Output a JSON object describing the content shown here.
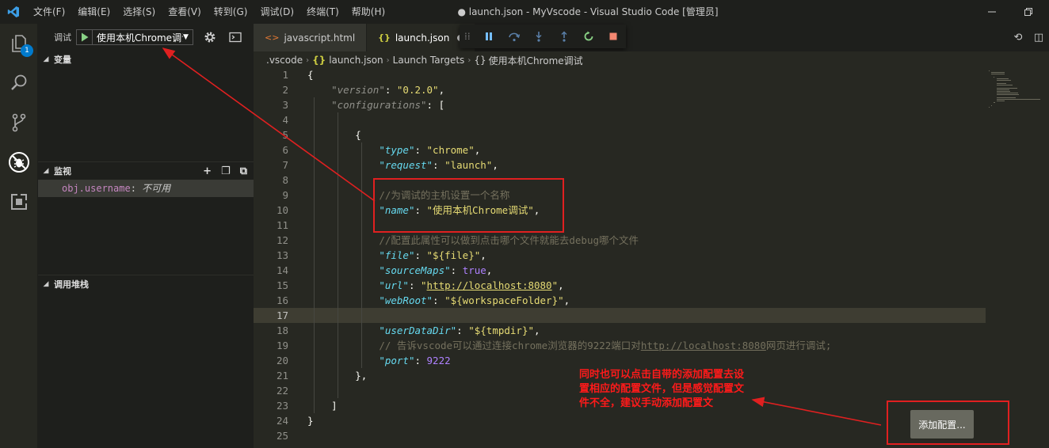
{
  "window": {
    "title": "● launch.json - MyVscode - Visual Studio Code [管理员]",
    "menu": [
      "文件(F)",
      "编辑(E)",
      "选择(S)",
      "查看(V)",
      "转到(G)",
      "调试(D)",
      "终端(T)",
      "帮助(H)"
    ]
  },
  "activity": {
    "explorer_badge": "1"
  },
  "sidebar": {
    "debug_label": "调试",
    "config_name": "使用本机Chrome调试",
    "sections": {
      "variables": "变量",
      "watch": "监视",
      "call_stack": "调用堆栈"
    },
    "watch_items": [
      {
        "name": "obj.username",
        "value": "不可用"
      }
    ]
  },
  "tabs": [
    {
      "label": "javascript.html",
      "icon": "html-icon",
      "active": false
    },
    {
      "label": "launch.json",
      "icon": "json-icon",
      "active": true,
      "dirty": true
    }
  ],
  "breadcrumb": [
    ".vscode",
    "launch.json",
    "Launch Targets",
    "使用本机Chrome调试"
  ],
  "code_lines": [
    "{",
    "    \"version\": \"0.2.0\",",
    "    \"configurations\": [",
    "",
    "        {",
    "            \"type\": \"chrome\",",
    "            \"request\": \"launch\",",
    "",
    "            //为调试的主机设置一个名称",
    "            \"name\": \"使用本机Chrome调试\",",
    "",
    "            //配置此属性可以做到点击哪个文件就能去debug哪个文件",
    "            \"file\": \"${file}\",",
    "            \"sourceMaps\": true,",
    "            \"url\": \"http://localhost:8080\",",
    "            \"webRoot\": \"${workspaceFolder}\",",
    "",
    "            \"userDataDir\": \"${tmpdir}\",",
    "            // 告诉vscode可以通过连接chrome浏览器的9222端口对http://localhost:8080网页进行调试;",
    "            \"port\": 9222",
    "        },",
    "",
    "    ]",
    "}",
    ""
  ],
  "current_line": 17,
  "annotation": {
    "text": "同时也可以点击自带的添加配置去设置相应的配置文件，但是感觉配置文件不全，建议手动添加配置文",
    "add_config_button": "添加配置..."
  },
  "colors": {
    "annotation_red": "#e02020",
    "accent": "#007acc"
  }
}
